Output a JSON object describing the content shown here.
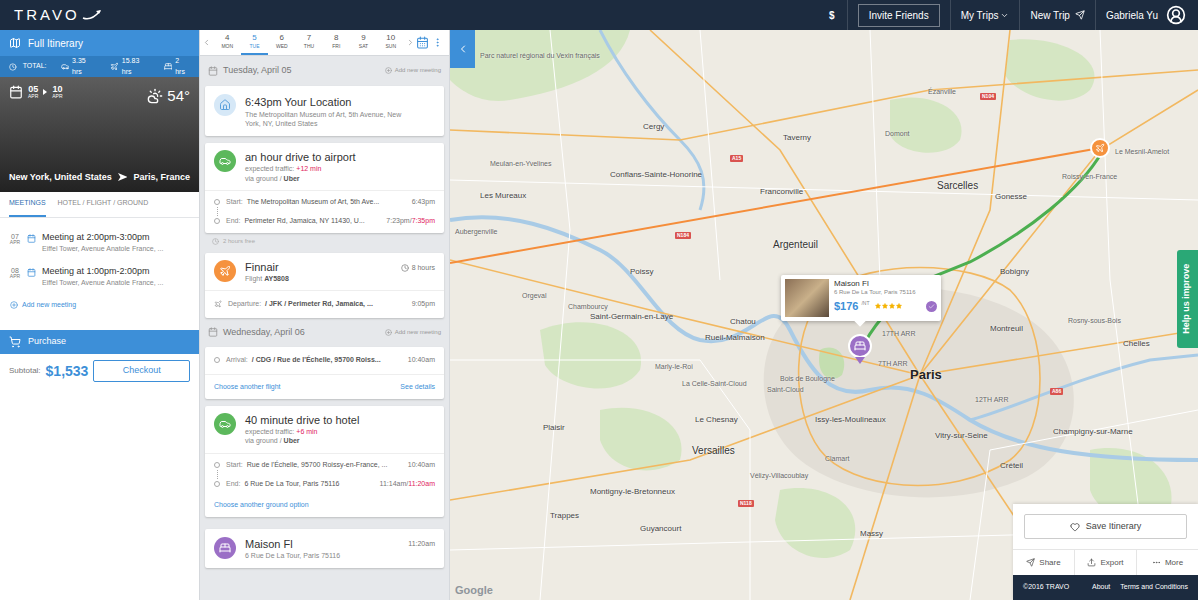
{
  "nav": {
    "logo": "TRAVO",
    "currency": "$",
    "invite": "Invite Friends",
    "my_trips": "My Trips",
    "new_trip": "New Trip",
    "user": "Gabriela Yu"
  },
  "itinerary": {
    "title": "Full Itinerary",
    "total_label": "TOTAL:",
    "totals": [
      {
        "kind": "car",
        "value": "3.35 hrs"
      },
      {
        "kind": "plane",
        "value": "15.83 hrs"
      },
      {
        "kind": "hotel",
        "value": "2 hrs"
      }
    ],
    "start": {
      "day": "05",
      "month": "APR"
    },
    "end": {
      "day": "10",
      "month": "APR"
    },
    "temperature": "54°",
    "from": "New York, United States",
    "to": "Paris, France"
  },
  "tabs": [
    {
      "label": "MEETINGS",
      "selected": true
    },
    {
      "label": "HOTEL / FLIGHT / GROUND",
      "selected": false
    }
  ],
  "meetings": [
    {
      "day": "07",
      "month": "APR",
      "title": "Meeting at 2:00pm-3:00pm",
      "place": "Eiffel Tower, Avenue Anatole France, ..."
    },
    {
      "day": "08",
      "month": "APR",
      "title": "Meeting at 1:00pm-2:00pm",
      "place": "Eiffel Tower, Avenue Anatole France, ..."
    }
  ],
  "add_meeting": "Add new meeting",
  "purchase": {
    "title": "Purchase",
    "subtotal_label": "Subtotal:",
    "subtotal": "$1,533",
    "checkout": "Checkout"
  },
  "day_strip": [
    {
      "day": "4",
      "weekday": "MON",
      "selected": false
    },
    {
      "day": "5",
      "weekday": "TUE",
      "selected": true
    },
    {
      "day": "6",
      "weekday": "WED",
      "selected": false
    },
    {
      "day": "7",
      "weekday": "THU",
      "selected": false
    },
    {
      "day": "8",
      "weekday": "FRI",
      "selected": false
    },
    {
      "day": "9",
      "weekday": "SAT",
      "selected": false
    },
    {
      "day": "10",
      "weekday": "SUN",
      "selected": false
    }
  ],
  "timeline": [
    {
      "kind": "date",
      "date": "Tuesday, April 05",
      "action": "Add new meeting"
    },
    {
      "kind": "location",
      "title": "6:43pm Your Location",
      "address": "The Metropolitan Museum of Art, 5th Avenue, New York, NY, United States"
    },
    {
      "kind": "ground",
      "title": "an hour drive to airport",
      "traffic_label": "expected traffic:",
      "traffic": "+12 min",
      "via": "via ground /",
      "provider": "Uber",
      "start_label": "Start:",
      "start": "The Metropolitan Museum of Art, 5th Ave...",
      "start_time": "6:43pm",
      "end_label": "End:",
      "end": "Perimeter Rd, Jamaica, NY 11430, U...",
      "end_time": "7:23pm/",
      "end_time_actual": "7:35pm"
    },
    {
      "kind": "free",
      "text": "2 hours free"
    },
    {
      "kind": "flight",
      "airline": "Finnair",
      "flight_label": "Flight",
      "flight": "AY5808",
      "duration": "8 hours",
      "departure_label": "Departure:",
      "departure": "/ JFK / Perimeter Rd, Jamaica, ...",
      "departure_time": "9:05pm"
    },
    {
      "kind": "date",
      "date": "Wednesday, April 06",
      "action": "Add new meeting"
    },
    {
      "kind": "arrival",
      "arrival_label": "Arrival:",
      "arrival": "/ CDG / Rue de l'Échelle, 95700 Roiss...",
      "arrival_time": "10:40am",
      "links": [
        "Choose another flight",
        "See details"
      ]
    },
    {
      "kind": "ground",
      "title": "40 minute drive to hotel",
      "traffic_label": "expected traffic:",
      "traffic": "+6 min",
      "via": "via ground /",
      "provider": "Uber",
      "start_label": "Start:",
      "start": "Rue de l'Échelle, 95700 Roissy-en-France, ...",
      "start_time": "10:40am",
      "end_label": "End:",
      "end": "6 Rue De La Tour, Paris 75116",
      "end_time": "11:14am/",
      "end_time_actual": "11:20am",
      "link": "Choose another ground option"
    },
    {
      "kind": "hotel",
      "name": "Maison Fl",
      "address": "6 Rue De La Tour, Paris 75116",
      "time": "11:20am"
    }
  ],
  "map": {
    "labels": [
      "Parc naturel régional du Vexin français",
      "Cergy",
      "Taverny",
      "Domont",
      "Ézanville",
      "Sarcelles",
      "Gonesse",
      "Franconville",
      "Conflans-Sainte-Honorine",
      "Meulan-en-Yvelines",
      "Les Mureaux",
      "Aubergenville",
      "Argenteuil",
      "Poissy",
      "Saint-Germain-en-Laye",
      "Chatou",
      "Rueil-Malmaison",
      "Chambourcy",
      "Orgeval",
      "Le Mesnil-Amelot",
      "Roissy-en-France",
      "Bobigny",
      "Montreuil",
      "Rosny-sous-Bois",
      "Chelles",
      "Paris",
      "17TH ARR",
      "7TH ARR",
      "12TH ARR",
      "Bois de Boulogne",
      "Saint-Cloud",
      "La Celle-Saint-Cloud",
      "Marly-le-Roi",
      "Le Chesnay",
      "Versailles",
      "Plaisir",
      "Issy-les-Moulineaux",
      "Vitry-sur-Seine",
      "Champigny-sur-Marne",
      "Créteil",
      "Montigny-le-Bretonneux",
      "Trappes",
      "Guyancourt",
      "Clamart",
      "Massy",
      "Vélizy-Villacoublay"
    ],
    "shields": [
      "N184",
      "N104",
      "A15",
      "A86",
      "N118"
    ],
    "popup": {
      "name": "Maison Fl",
      "address": "6 Rue De La Tour, Paris 75116",
      "price": "$176",
      "per": "/NT",
      "stars": 4,
      "selected": true
    },
    "help": "Help us improve",
    "attribution": "Google"
  },
  "actions": {
    "save": "Save Itinerary",
    "buttons": [
      {
        "kind": "share",
        "label": "Share"
      },
      {
        "kind": "export",
        "label": "Export"
      },
      {
        "kind": "more",
        "label": "More"
      }
    ]
  },
  "footer": {
    "copyright": "©2016 TRAVO",
    "links": [
      "About",
      "Terms and Conditions"
    ]
  }
}
